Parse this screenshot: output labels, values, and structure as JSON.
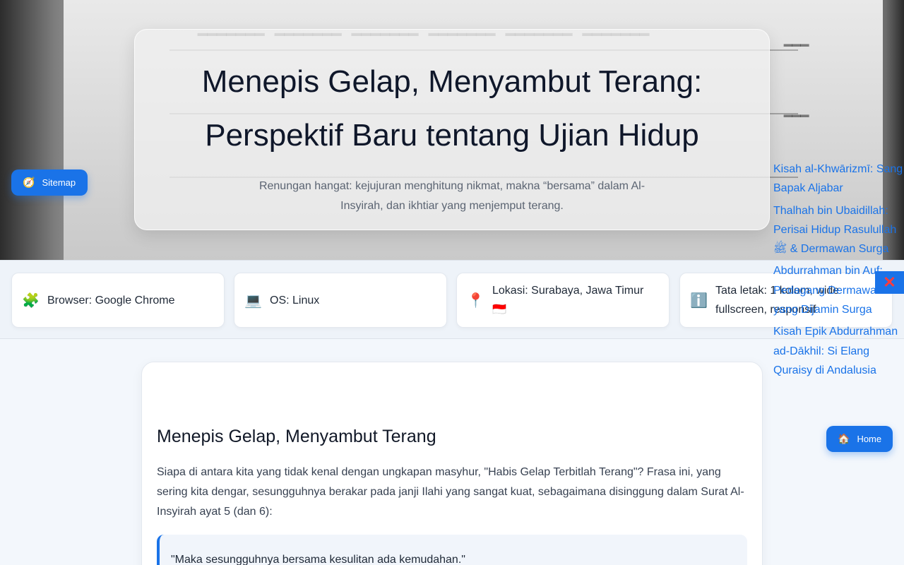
{
  "hero": {
    "title": "Menepis Gelap, Menyambut Terang: Perspektif Baru tentang Ujian Hidup",
    "subtitle": "Renungan hangat: kejujuran menghitung nikmat, makna “bersama” dalam Al-Insyirah, dan ikhtiar yang menjemput terang."
  },
  "sitemap": {
    "icon": "compass-icon",
    "label": "Sitemap"
  },
  "home": {
    "icon": "house-icon",
    "label": "Home"
  },
  "info": [
    {
      "icon": "puzzle-icon",
      "glyph": "🧩",
      "text": "Browser: Google Chrome"
    },
    {
      "icon": "laptop-icon",
      "glyph": "💻",
      "text": "OS: Linux"
    },
    {
      "icon": "pin-icon",
      "glyph": "📍",
      "text": "Lokasi: Surabaya, Jawa Timur 🇮🇩"
    },
    {
      "icon": "info-icon",
      "glyph": "ℹ️",
      "text": "Tata letak: 1 kolom, wide fullscreen, responsif"
    }
  ],
  "article": {
    "title": "Menepis Gelap, Menyambut Terang",
    "paragraph": "Siapa di antara kita yang tidak kenal dengan ungkapan masyhur, \"Habis Gelap Terbitlah Terang\"? Frasa ini, yang sering kita dengar, sesungguhnya berakar pada janji Ilahi yang sangat kuat, sebagaimana disinggung dalam Surat Al-Insyirah ayat 5 (dan 6):",
    "quote": "\"Maka sesungguhnya bersama kesulitan ada kemudahan.\""
  },
  "related": [
    "Kisah al-Khwārizmī: Sang Bapak Aljabar",
    "Thalhah bin Ubaidillah: Perisai Hidup Rasulullah ﷺ & Dermawan Surga",
    "Abdurrahman bin Auf: Pedagang Dermawan yang Dijamin Surga",
    "Kisah Epik Abdurrahman ad-Dākhil: Si Elang Quraisy di Andalusia"
  ],
  "close": {
    "icon": "close-icon",
    "glyph": "✕"
  },
  "colors": {
    "accent": "#1a73e8",
    "close_x": "#ff3b3b"
  }
}
